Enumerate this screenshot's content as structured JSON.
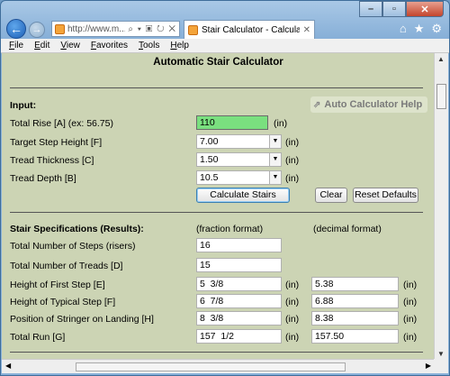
{
  "browser": {
    "address": "http://www.m...",
    "address_icons": "⌕ ▾ ▣ ↻ ✕",
    "tab_title": "Stair Calculator - Calculate ...",
    "menu": [
      "File",
      "Edit",
      "View",
      "Favorites",
      "Tools",
      "Help"
    ]
  },
  "page": {
    "title": "Automatic Stair Calculator",
    "input_heading": "Input:",
    "help_button": "Auto Calculator Help",
    "fields": [
      {
        "label": "Total Rise [A] (ex: 56.75)",
        "value": "110",
        "unit": "(in)"
      },
      {
        "label": "Target Step Height [F]",
        "value": "7.00",
        "unit": "(in)"
      },
      {
        "label": "Tread Thickness [C]",
        "value": "1.50",
        "unit": "(in)"
      },
      {
        "label": "Tread Depth [B]",
        "value": "10.5",
        "unit": "(in)"
      }
    ],
    "buttons": {
      "calculate": "Calculate Stairs",
      "clear": "Clear",
      "reset": "Reset Defaults"
    },
    "results_heading": "Stair Specifications (Results):",
    "fraction_header": "(fraction format)",
    "decimal_header": "(decimal format)",
    "results": [
      {
        "label": "Total Number of Steps (risers)",
        "fraction": "16",
        "decimal": "",
        "unit": ""
      },
      {
        "label": "Total Number of Treads [D]",
        "fraction": "15",
        "decimal": "",
        "unit": ""
      },
      {
        "label": "Height of First Step [E]",
        "fraction": "5  3/8",
        "decimal": "5.38",
        "unit": "(in)"
      },
      {
        "label": "Height of Typical  Step [F]",
        "fraction": "6  7/8",
        "decimal": "6.88",
        "unit": "(in)"
      },
      {
        "label": "Position of Stringer on Landing [H]",
        "fraction": "8  3/8",
        "decimal": "8.38",
        "unit": "(in)"
      },
      {
        "label": "Total Run [G]",
        "fraction": "157  1/2",
        "decimal": "157.50",
        "unit": "(in)"
      }
    ]
  },
  "colors": {
    "page_bg": "#ccd4b4",
    "highlight_input": "#7ae07f"
  }
}
